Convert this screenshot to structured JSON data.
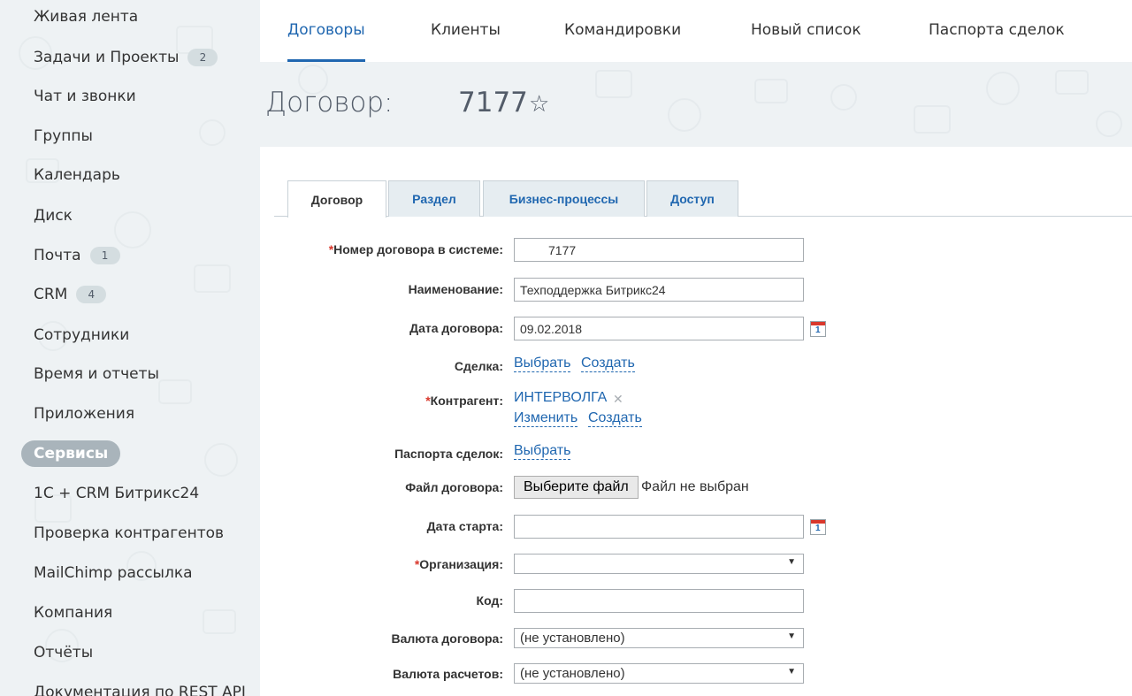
{
  "sidebar": {
    "items": [
      {
        "label": "Живая лента"
      },
      {
        "label": "Задачи и Проекты",
        "badge": "2"
      },
      {
        "label": "Чат и звонки"
      },
      {
        "label": "Группы"
      },
      {
        "label": "Календарь"
      },
      {
        "label": "Диск"
      },
      {
        "label": "Почта",
        "badge": "1"
      },
      {
        "label": "CRM",
        "badge": "4"
      },
      {
        "label": "Сотрудники"
      },
      {
        "label": "Время и отчеты"
      },
      {
        "label": "Приложения"
      },
      {
        "label": "Сервисы",
        "active": true
      },
      {
        "label": "1С + CRM Битрикс24"
      },
      {
        "label": "Проверка контрагентов"
      },
      {
        "label": "MailChimp рассылка"
      },
      {
        "label": "Компания"
      },
      {
        "label": "Отчёты"
      },
      {
        "label": "Документация по REST API"
      }
    ]
  },
  "topnav": {
    "tabs": [
      {
        "label": "Договоры",
        "active": true
      },
      {
        "label": "Клиенты"
      },
      {
        "label": "Командировки"
      },
      {
        "label": "Новый список"
      },
      {
        "label": "Паспорта сделок"
      }
    ]
  },
  "header": {
    "title": "Договор:",
    "number": "7177",
    "favorite_icon": "star-outline-icon"
  },
  "form": {
    "tabs": [
      {
        "label": "Договор",
        "active": true
      },
      {
        "label": "Раздел"
      },
      {
        "label": "Бизнес-процессы"
      },
      {
        "label": "Доступ"
      }
    ],
    "required_mark": "*",
    "contract_number": {
      "label": "Номер договора в системе:",
      "value": "7177"
    },
    "name": {
      "label": "Наименование:",
      "value": "Техподдержка Битрикс24"
    },
    "contract_date": {
      "label": "Дата договора:",
      "value": "09.02.2018"
    },
    "deal": {
      "label": "Сделка:",
      "select": "Выбрать",
      "create": "Создать"
    },
    "contractor": {
      "label": "Контрагент:",
      "value": "ИНТЕРВОЛГА",
      "change": "Изменить",
      "create": "Создать"
    },
    "deal_passports": {
      "label": "Паспорта сделок:",
      "select": "Выбрать"
    },
    "contract_file": {
      "label": "Файл договора:",
      "button": "Выберите файл",
      "status": "Файл не выбран"
    },
    "start_date": {
      "label": "Дата старта:",
      "value": ""
    },
    "organization": {
      "label": "Организация:",
      "value": ""
    },
    "code": {
      "label": "Код:",
      "value": ""
    },
    "contract_currency": {
      "label": "Валюта договора:",
      "value": "(не установлено)"
    },
    "settlement_currency": {
      "label": "Валюта расчетов:",
      "value": "(не установлено)"
    },
    "calendar_day": "1"
  },
  "colors": {
    "accent": "#2067b0",
    "required": "#d9382c",
    "sidebar_bg": "#eef2f4",
    "active_pill": "#a9b4bb"
  }
}
